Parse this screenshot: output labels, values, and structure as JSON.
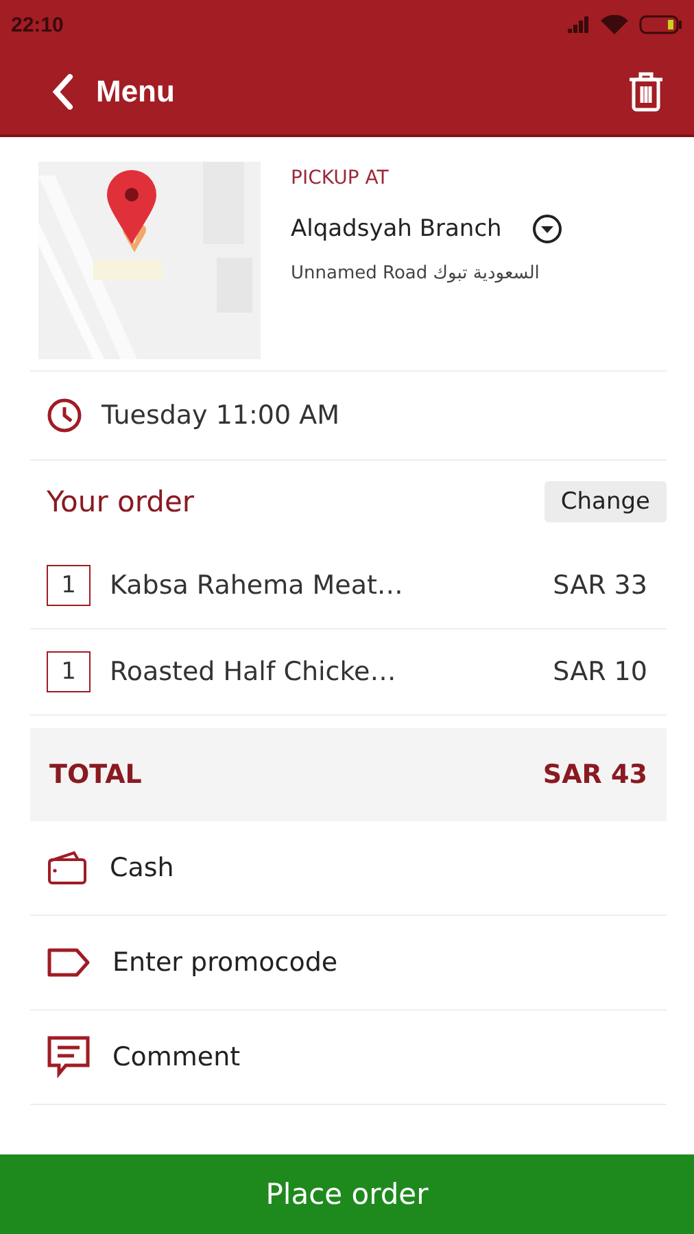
{
  "status_bar": {
    "time": "22:10"
  },
  "app_bar": {
    "title": "Menu"
  },
  "pickup": {
    "label": "PICKUP AT",
    "branch": "Alqadsyah Branch",
    "address": "Unnamed Road السعودية تبوك"
  },
  "schedule": {
    "text": "Tuesday 11:00 AM"
  },
  "order": {
    "title": "Your order",
    "change_button": "Change",
    "items": [
      {
        "qty": "1",
        "name": "Kabsa Rahema Meat…",
        "price": "SAR 33"
      },
      {
        "qty": "1",
        "name": "Roasted Half Chicke…",
        "price": "SAR 10"
      }
    ],
    "total": {
      "label": "TOTAL",
      "value": "SAR 43"
    }
  },
  "options": [
    {
      "kind": "cash",
      "label": "Cash"
    },
    {
      "kind": "promo",
      "label": "Enter promocode"
    },
    {
      "kind": "comment",
      "label": "Comment"
    }
  ],
  "place_order_button": "Place order"
}
